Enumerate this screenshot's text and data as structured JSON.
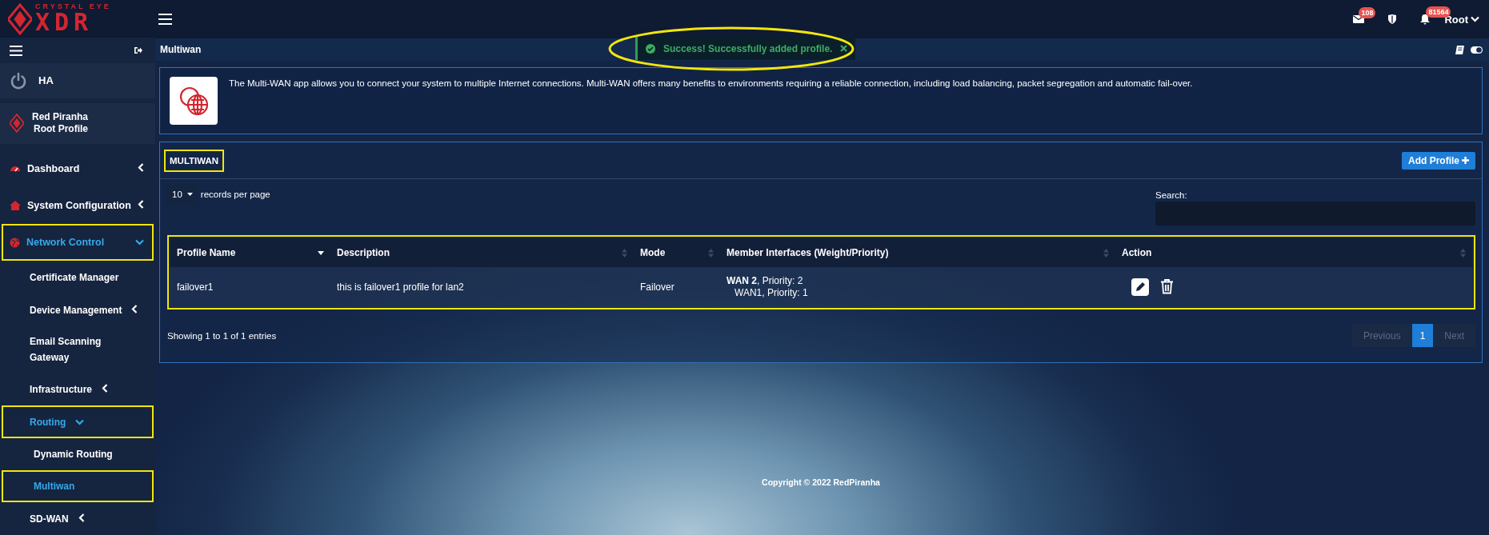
{
  "logo": {
    "brand": "CRYSTAL EYE",
    "product": "XDR"
  },
  "topbar": {
    "mail_badge": "108",
    "alerts_badge": "81564",
    "user": "Root"
  },
  "sidebar": {
    "ha": {
      "label": "HA"
    },
    "profile": {
      "name": "Red Piranha",
      "role": "Root Profile"
    },
    "items": [
      {
        "label": "Dashboard",
        "selected": false,
        "highlighted": false,
        "expanded": false
      },
      {
        "label": "System Configuration",
        "selected": false,
        "highlighted": false,
        "expanded": false
      },
      {
        "label": "Network Control",
        "selected": true,
        "highlighted": true,
        "expanded": true,
        "children": [
          {
            "label": "Certificate Manager",
            "selected": false,
            "highlighted": false
          },
          {
            "label": "Device Management",
            "selected": false,
            "highlighted": false,
            "expanded": false
          },
          {
            "label": "Email Scanning Gateway",
            "selected": false,
            "highlighted": false
          },
          {
            "label": "Infrastructure",
            "selected": false,
            "highlighted": false,
            "expanded": false
          },
          {
            "label": "Routing",
            "selected": true,
            "highlighted": true,
            "expanded": true,
            "children": [
              {
                "label": "Dynamic Routing",
                "selected": false,
                "highlighted": false
              },
              {
                "label": "Multiwan",
                "selected": true,
                "highlighted": true
              }
            ]
          },
          {
            "label": "SD-WAN",
            "selected": false,
            "highlighted": false,
            "expanded": false
          }
        ]
      }
    ]
  },
  "page_header": {
    "title": "Multiwan"
  },
  "toast": {
    "strong": "Success!",
    "message": "Successfully added profile.",
    "highlighted": true
  },
  "info": {
    "text": "The Multi-WAN app allows you to connect your system to multiple Internet connections. Multi-WAN offers many benefits to environments requiring a reliable connection, including load balancing, packet segregation and automatic fail-over."
  },
  "panel": {
    "title": "MULTIWAN",
    "title_highlighted": true,
    "add_button": "Add Profile",
    "page_length": "10",
    "page_length_label": "records per page",
    "search_label": "Search:",
    "table": {
      "highlighted": true,
      "columns": [
        {
          "label": "Profile Name",
          "sorted": true
        },
        {
          "label": "Description",
          "sorted": false
        },
        {
          "label": "Mode",
          "sorted": false
        },
        {
          "label": "Member Interfaces (Weight/Priority)",
          "sorted": false
        },
        {
          "label": "Action",
          "sorted": false
        }
      ],
      "rows": [
        {
          "profile_name": "failover1",
          "description": "this is failover1 profile for lan2",
          "mode": "Failover",
          "members": [
            "**WAN 2**, Priority: 2",
            "WAN1, Priority: 1"
          ]
        }
      ]
    },
    "summary": "Showing 1 to 1 of 1 entries",
    "pagination": [
      {
        "label": "Previous",
        "selected": false,
        "disabled": true
      },
      {
        "label": "1",
        "selected": true,
        "disabled": false
      },
      {
        "label": "Next",
        "selected": false,
        "disabled": true
      }
    ]
  },
  "footer": "Copyright © 2022 RedPiranha"
}
